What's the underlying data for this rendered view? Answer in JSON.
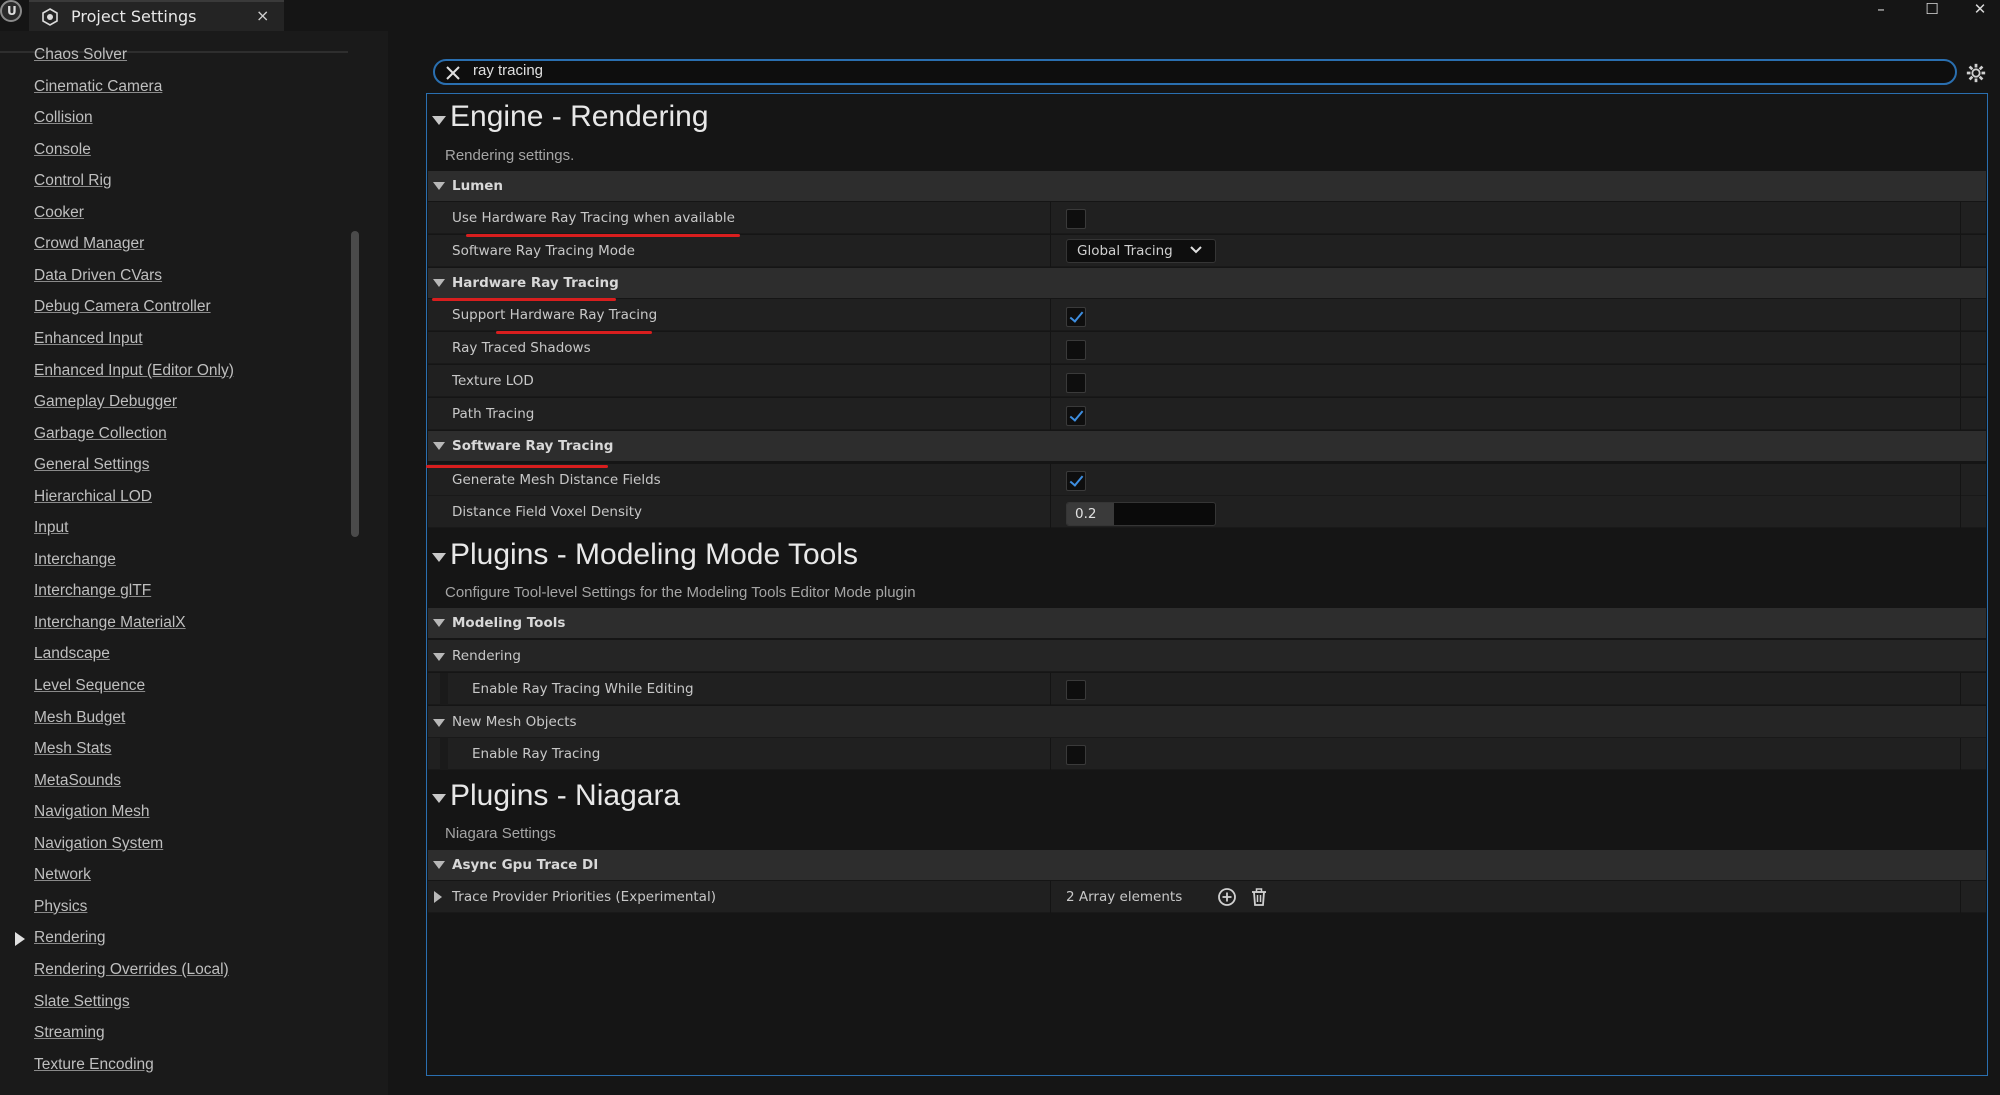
{
  "window": {
    "tab_title": "Project Settings",
    "close_glyph": "×",
    "minimize_glyph": "–",
    "maximize_glyph": "☐",
    "close_window_glyph": "✕"
  },
  "sidebar": {
    "items": [
      {
        "label": "Chaos Solver"
      },
      {
        "label": "Cinematic Camera"
      },
      {
        "label": "Collision"
      },
      {
        "label": "Console"
      },
      {
        "label": "Control Rig"
      },
      {
        "label": "Cooker"
      },
      {
        "label": "Crowd Manager"
      },
      {
        "label": "Data Driven CVars"
      },
      {
        "label": "Debug Camera Controller"
      },
      {
        "label": "Enhanced Input"
      },
      {
        "label": "Enhanced Input (Editor Only)"
      },
      {
        "label": "Gameplay Debugger"
      },
      {
        "label": "Garbage Collection"
      },
      {
        "label": "General Settings"
      },
      {
        "label": "Hierarchical LOD"
      },
      {
        "label": "Input"
      },
      {
        "label": "Interchange"
      },
      {
        "label": "Interchange glTF"
      },
      {
        "label": "Interchange MaterialX"
      },
      {
        "label": "Landscape"
      },
      {
        "label": "Level Sequence"
      },
      {
        "label": "Mesh Budget"
      },
      {
        "label": "Mesh Stats"
      },
      {
        "label": "MetaSounds"
      },
      {
        "label": "Navigation Mesh"
      },
      {
        "label": "Navigation System"
      },
      {
        "label": "Network"
      },
      {
        "label": "Physics"
      },
      {
        "label": "Rendering",
        "selected": true
      },
      {
        "label": "Rendering Overrides (Local)"
      },
      {
        "label": "Slate Settings"
      },
      {
        "label": "Streaming"
      },
      {
        "label": "Texture Encoding"
      }
    ]
  },
  "search": {
    "value": "ray tracing"
  },
  "engine_rendering": {
    "title": "Engine - Rendering",
    "description": "Rendering settings.",
    "lumen": {
      "label": "Lumen",
      "use_hw_rt": {
        "label": "Use Hardware Ray Tracing when available",
        "checked": false
      },
      "sw_rt_mode": {
        "label": "Software Ray Tracing Mode",
        "value": "Global Tracing"
      }
    },
    "hardware_rt": {
      "label": "Hardware Ray Tracing",
      "support_hw_rt": {
        "label": "Support Hardware Ray Tracing",
        "checked": true
      },
      "rt_shadows": {
        "label": "Ray Traced Shadows",
        "checked": false
      },
      "texture_lod": {
        "label": "Texture LOD",
        "checked": false
      },
      "path_tracing": {
        "label": "Path Tracing",
        "checked": true
      }
    },
    "software_rt": {
      "label": "Software Ray Tracing",
      "gen_mesh_df": {
        "label": "Generate Mesh Distance Fields",
        "checked": true
      },
      "df_voxel_density": {
        "label": "Distance Field Voxel Density",
        "value": "0.2",
        "fill_fraction": 0.32
      }
    }
  },
  "modeling_tools": {
    "title": "Plugins - Modeling Mode Tools",
    "description": "Configure Tool-level Settings for the Modeling Tools Editor Mode plugin",
    "section_label": "Modeling Tools",
    "rendering": {
      "label": "Rendering",
      "enable_rt_editing": {
        "label": "Enable Ray Tracing While Editing",
        "checked": false
      }
    },
    "new_mesh": {
      "label": "New Mesh Objects",
      "enable_rt": {
        "label": "Enable Ray Tracing",
        "checked": false
      }
    }
  },
  "niagara": {
    "title": "Plugins - Niagara",
    "description": "Niagara Settings",
    "section_label": "Async Gpu Trace DI",
    "trace_priorities": {
      "label": "Trace Provider Priorities (Experimental)",
      "value": "2 Array elements"
    }
  },
  "colors": {
    "accent_blue": "#2a6fb0",
    "check_blue": "#3e8ee0",
    "annotation_red": "#d81e1e",
    "background": "#151515"
  },
  "icons": [
    "unreal-logo",
    "project-settings-icon",
    "clear-search-icon",
    "gear-icon",
    "chevron-down-icon",
    "add-element-icon",
    "trash-icon"
  ]
}
